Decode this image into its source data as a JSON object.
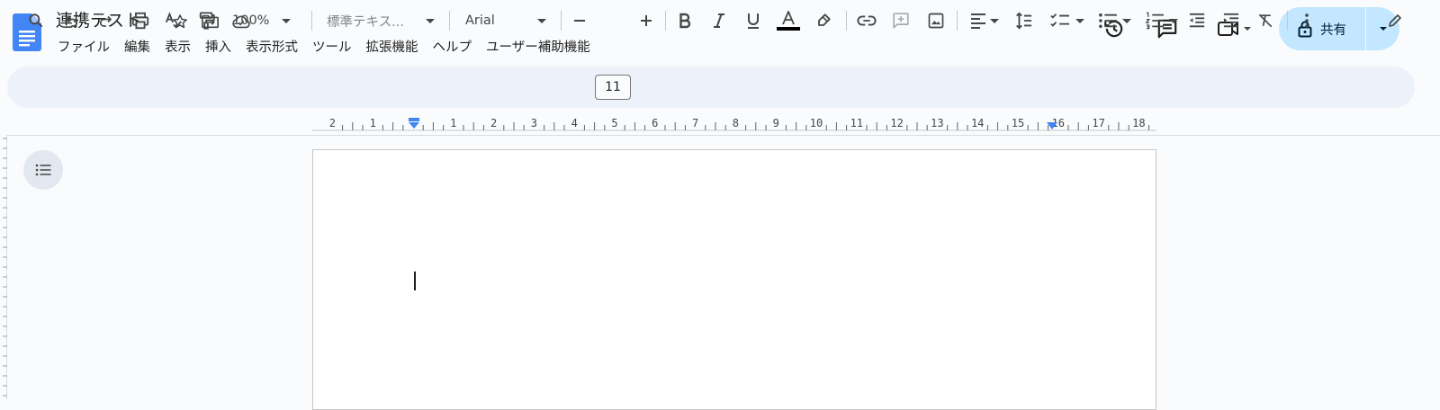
{
  "document": {
    "title": "連携テスト"
  },
  "menu": [
    "ファイル",
    "編集",
    "表示",
    "挿入",
    "表示形式",
    "ツール",
    "拡張機能",
    "ヘルプ",
    "ユーザー補助機能"
  ],
  "share": {
    "label": "共有"
  },
  "toolbar": {
    "zoom": "100%",
    "style": "標準テキス...",
    "font": "Arial",
    "font_size": "11",
    "text_color": "#000000"
  },
  "ruler": {
    "numbers": [
      "2",
      "1",
      "1",
      "2",
      "3",
      "4",
      "5",
      "6",
      "7",
      "8",
      "9",
      "10",
      "11",
      "12",
      "13",
      "14",
      "15",
      "16",
      "17",
      "18"
    ]
  },
  "colors": {
    "accent": "#0b57d0",
    "share_bg": "#c2e7ff",
    "toolbar_bg": "#edf2fa"
  }
}
